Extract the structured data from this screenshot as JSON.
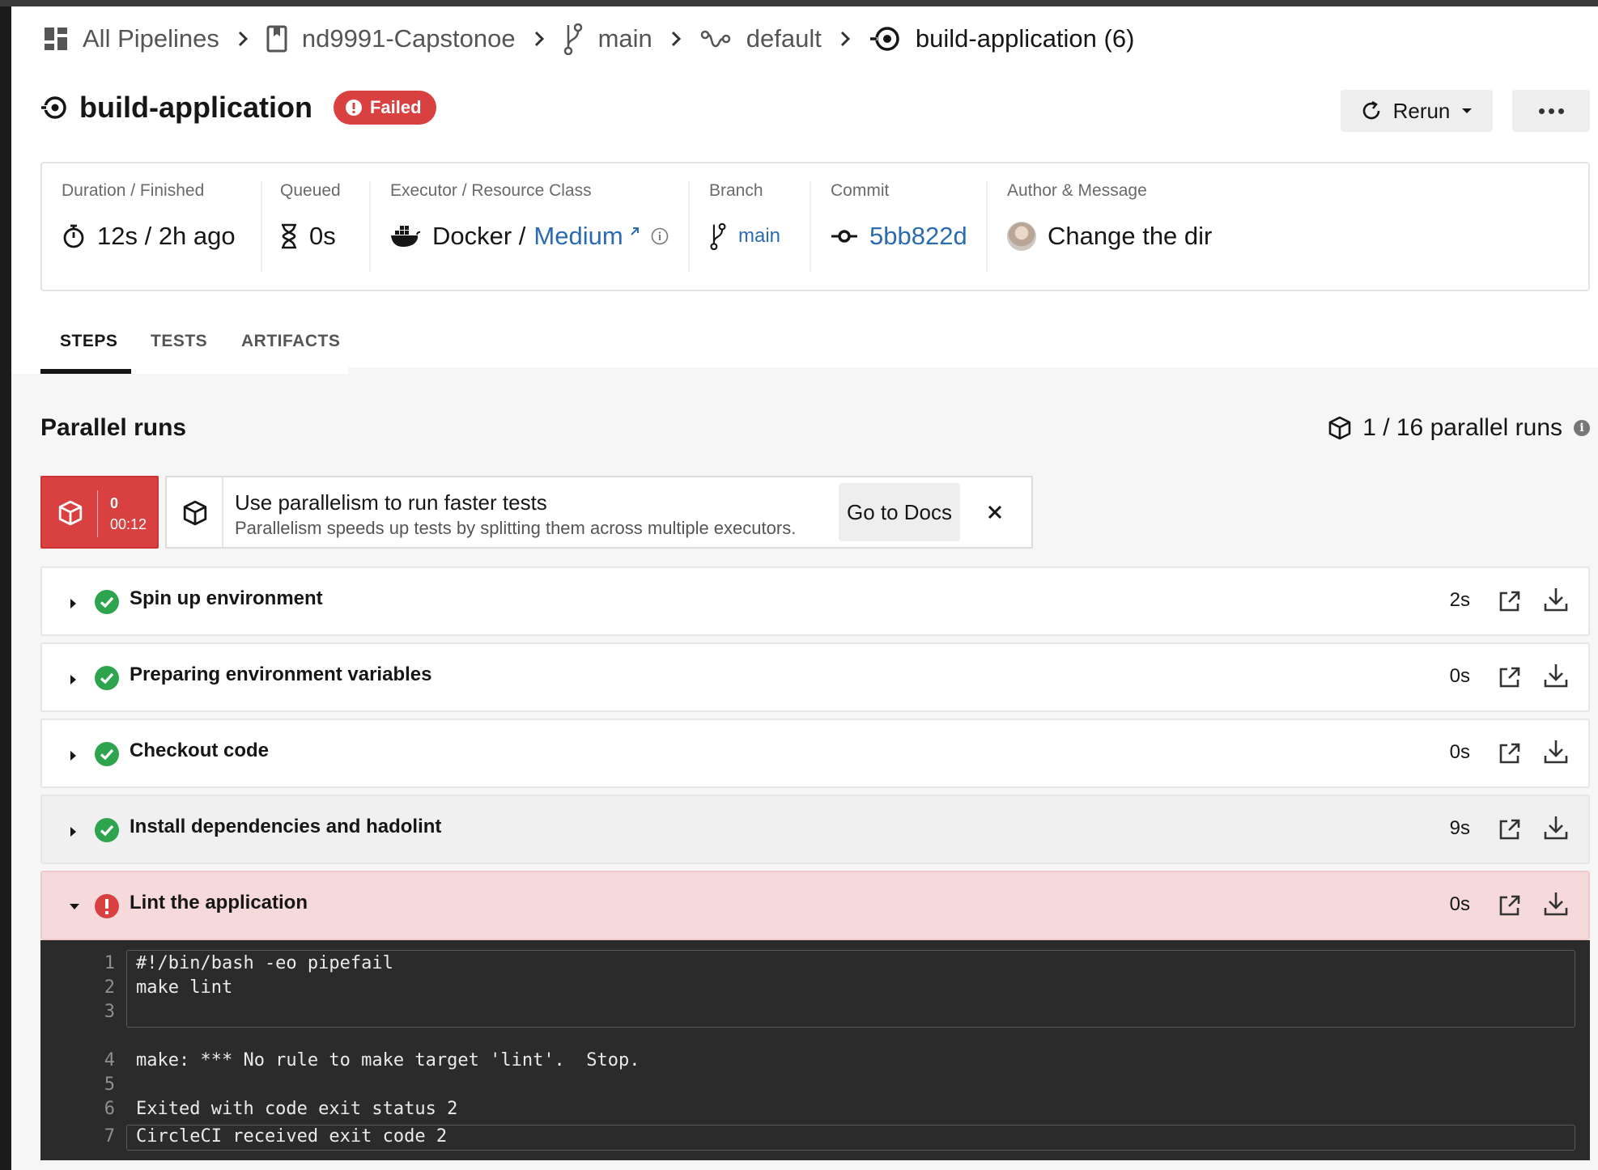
{
  "breadcrumb": {
    "items": [
      {
        "label": "All Pipelines",
        "icon": "dashboard-icon"
      },
      {
        "label": "nd9991-Capstonoe",
        "icon": "project-icon"
      },
      {
        "label": "main",
        "icon": "branch-icon"
      },
      {
        "label": "default",
        "icon": "workflow-icon"
      },
      {
        "label": "build-application (6)",
        "icon": "job-icon"
      }
    ]
  },
  "header": {
    "title": "build-application",
    "status": "Failed",
    "rerun_label": "Rerun"
  },
  "info": {
    "duration_label": "Duration / Finished",
    "duration_value": "12s / 2h ago",
    "queued_label": "Queued",
    "queued_value": "0s",
    "executor_label": "Executor / Resource Class",
    "executor_name": "Docker /",
    "resource_class": "Medium",
    "branch_label": "Branch",
    "branch_value": "main",
    "commit_label": "Commit",
    "commit_value": "5bb822d",
    "author_label": "Author & Message",
    "message": "Change the dir"
  },
  "tabs": [
    "STEPS",
    "TESTS",
    "ARTIFACTS"
  ],
  "active_tab": "STEPS",
  "parallel": {
    "title": "Parallel runs",
    "count_text": "1 / 16 parallel runs",
    "run_index": "0",
    "run_time": "00:12",
    "promo_title": "Use parallelism to run faster tests",
    "promo_sub": "Parallelism speeds up tests by splitting them across multiple executors.",
    "docs_label": "Go to Docs"
  },
  "steps": [
    {
      "name": "Spin up environment",
      "duration": "2s",
      "status": "success"
    },
    {
      "name": "Preparing environment variables",
      "duration": "0s",
      "status": "success"
    },
    {
      "name": "Checkout code",
      "duration": "0s",
      "status": "success"
    },
    {
      "name": "Install dependencies and hadolint",
      "duration": "9s",
      "status": "success"
    },
    {
      "name": "Lint the application",
      "duration": "0s",
      "status": "failed"
    }
  ],
  "log": [
    {
      "n": "1",
      "text": "#!/bin/bash -eo pipefail"
    },
    {
      "n": "2",
      "text": "make lint"
    },
    {
      "n": "3",
      "text": ""
    },
    {
      "n": "4",
      "text": "make: *** No rule to make target 'lint'.  Stop."
    },
    {
      "n": "5",
      "text": ""
    },
    {
      "n": "6",
      "text": "Exited with code exit status 2"
    },
    {
      "n": "7",
      "text": "CircleCI received exit code 2"
    }
  ],
  "colors": {
    "failed_red": "#d94141",
    "success_green": "#2ea44f",
    "link_blue": "#2b6cb0",
    "failed_row_bg": "#f6dadb",
    "log_bg": "#2b2b2b"
  }
}
